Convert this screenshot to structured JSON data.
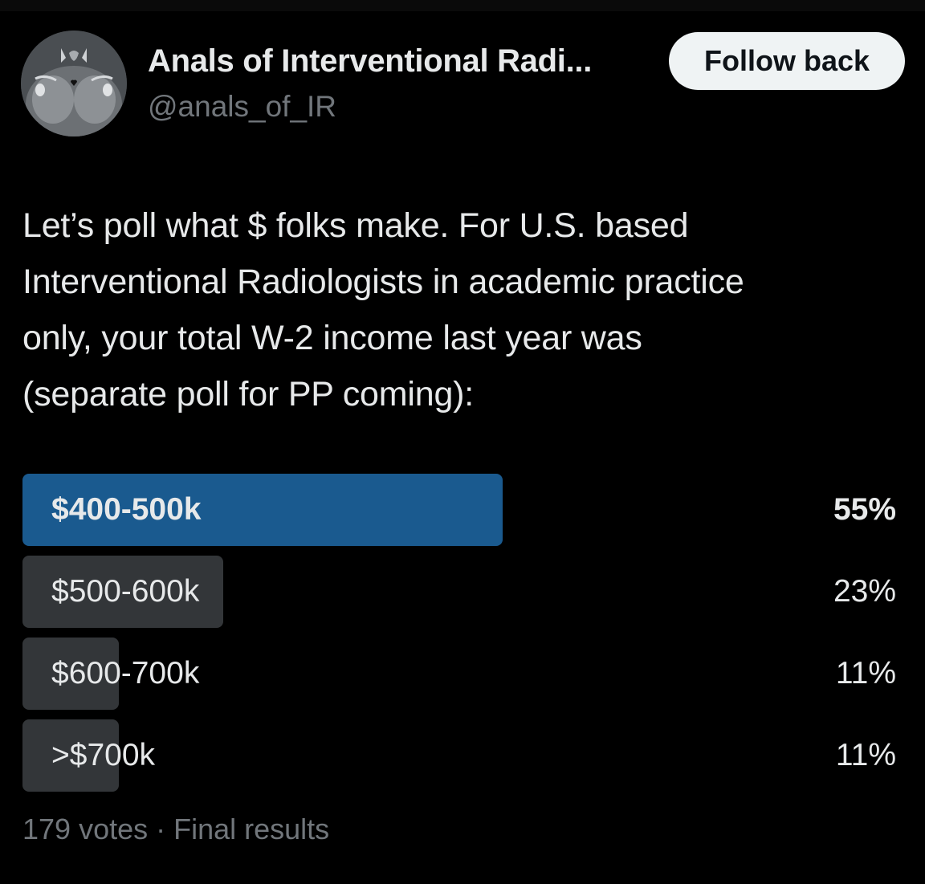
{
  "account": {
    "display_name": "Anals of Interventional Radi...",
    "handle": "@anals_of_IR",
    "avatar_icon": "ct-scan-avatar-icon",
    "follow_label": "Follow back"
  },
  "tweet": {
    "lines": [
      "Let’s poll what $ folks make. For U.S. based",
      "Interventional Radiologists in academic practice",
      "only, your total W-2 income last year was",
      "(separate poll for PP coming):"
    ]
  },
  "poll": {
    "options": [
      {
        "label": "$400-500k",
        "percent_text": "55%",
        "percent": 55,
        "winner": true
      },
      {
        "label": "$500-600k",
        "percent_text": "23%",
        "percent": 23,
        "winner": false
      },
      {
        "label": "$600-700k",
        "percent_text": "11%",
        "percent": 11,
        "winner": false
      },
      {
        "label": ">$700k",
        "percent_text": "11%",
        "percent": 11,
        "winner": false
      }
    ],
    "meta": "179 votes · Final results"
  },
  "colors": {
    "background": "#000000",
    "winner_bar": "#1a5a8f",
    "other_bar": "#333639",
    "secondary_text": "#71767b"
  }
}
